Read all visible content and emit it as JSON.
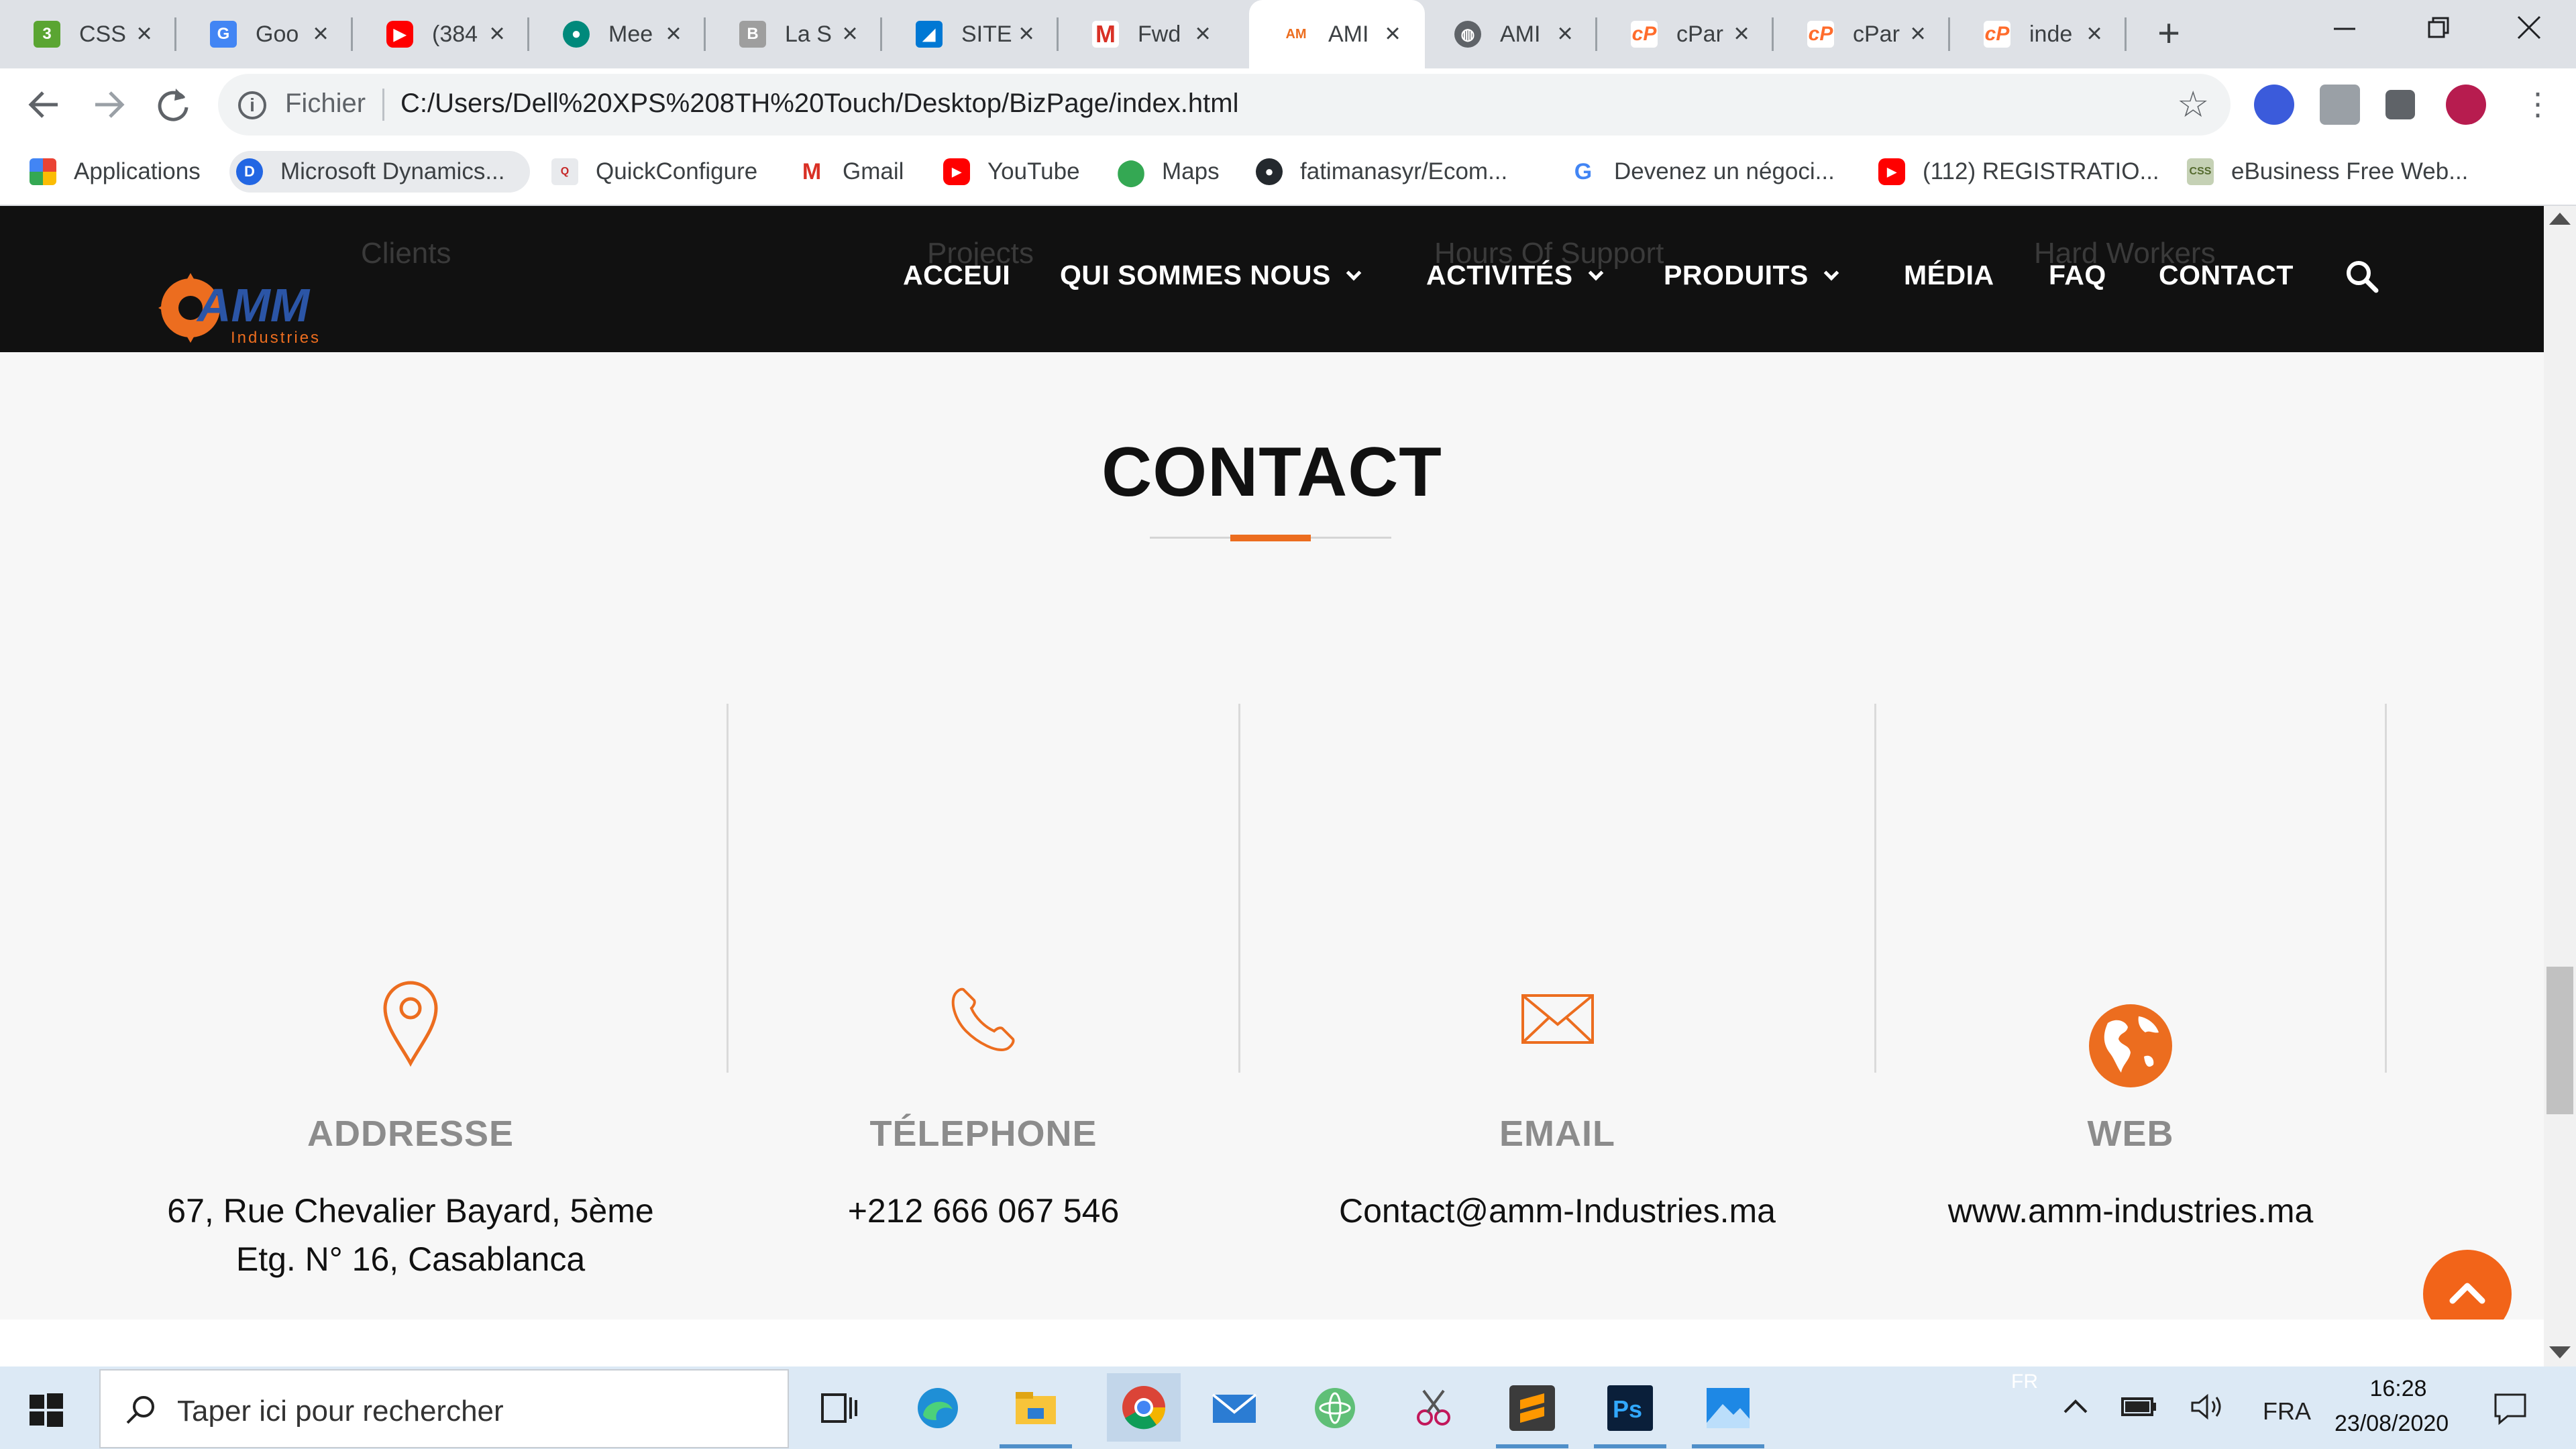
{
  "browser": {
    "tabs": [
      {
        "label": "CSS",
        "icon": "css-icon",
        "color": "#5aa532"
      },
      {
        "label": "Goo",
        "icon": "google-translate-icon",
        "color": "#4285f4"
      },
      {
        "label": "(384",
        "icon": "youtube-icon",
        "color": "#ff0000"
      },
      {
        "label": "Mee",
        "icon": "meet-icon",
        "color": "#00897b"
      },
      {
        "label": "La S",
        "icon": "document-icon",
        "color": "#9e9e9e"
      },
      {
        "label": "SITE",
        "icon": "azure-devops-icon",
        "color": "#0078d4"
      },
      {
        "label": "Fwd",
        "icon": "gmail-icon",
        "color": "#d93025"
      },
      {
        "label": "AMI",
        "icon": "amm-favicon",
        "color": "#ec6d1f",
        "active": true
      },
      {
        "label": "AMI",
        "icon": "globe-icon",
        "color": "#5f6368"
      },
      {
        "label": "cPar",
        "icon": "cpanel-icon",
        "color": "#ff6c2c"
      },
      {
        "label": "cPar",
        "icon": "cpanel-icon",
        "color": "#ff6c2c"
      },
      {
        "label": "inde",
        "icon": "cpanel-icon",
        "color": "#ff6c2c"
      }
    ],
    "new_tab": "+",
    "address": {
      "scheme_label": "Fichier",
      "url": "C:/Users/Dell%20XPS%208TH%20Touch/Desktop/BizPage/index.html"
    },
    "bookmarks": [
      {
        "label": "Applications",
        "icon": "apps-grid-icon"
      },
      {
        "label": "Microsoft Dynamics...",
        "icon": "dynamics-icon",
        "highlight": true
      },
      {
        "label": "QuickConfigure",
        "icon": "quickconfigure-icon"
      },
      {
        "label": "Gmail",
        "icon": "gmail-icon"
      },
      {
        "label": "YouTube",
        "icon": "youtube-icon"
      },
      {
        "label": "Maps",
        "icon": "maps-icon"
      },
      {
        "label": "fatimanasyr/Ecom...",
        "icon": "github-icon"
      },
      {
        "label": "Devenez un négoci...",
        "icon": "google-icon"
      },
      {
        "label": "(112) REGISTRATIO...",
        "icon": "youtube-icon"
      },
      {
        "label": "eBusiness Free Web...",
        "icon": "ebusiness-icon"
      }
    ]
  },
  "site": {
    "ghost_stats": [
      "Clients",
      "Projects",
      "Hours Of Support",
      "Hard Workers"
    ],
    "logo_text": "AMM",
    "logo_sub": "Industries",
    "nav": {
      "accueil": "ACCEUI",
      "qui": "QUI SOMMES NOUS",
      "activites": "ACTIVITÉS",
      "produits": "PRODUITS",
      "media": "MÉDIA",
      "faq": "FAQ",
      "contact": "CONTACT"
    },
    "section_title": "CONTACT",
    "cards": [
      {
        "title": "ADDRESSE",
        "line1": "67, Rue Chevalier Bayard, 5ème",
        "line2": "Etg. N° 16, Casablanca",
        "icon": "map-pin-icon"
      },
      {
        "title": "TÉLEPHONE",
        "line1": "+212 666 067 546",
        "icon": "phone-icon"
      },
      {
        "title": "EMAIL",
        "line1": "Contact@amm-Industries.ma",
        "icon": "envelope-icon"
      },
      {
        "title": "WEB",
        "line1": "www.amm-industries.ma",
        "icon": "globe-icon"
      }
    ],
    "accent_color": "#ec6d1f",
    "header_bg": "#111111"
  },
  "taskbar": {
    "search_placeholder": "Taper ici pour rechercher",
    "apps": [
      "task-view-icon",
      "edge-icon",
      "file-explorer-icon",
      "chrome-icon",
      "mail-icon",
      "atom-icon",
      "snipping-tool-icon",
      "sublime-text-icon",
      "photoshop-icon",
      "photos-icon"
    ],
    "tray": {
      "ghost_lang": "FR",
      "lang": "FRA",
      "time": "16:28",
      "date": "23/08/2020"
    }
  }
}
